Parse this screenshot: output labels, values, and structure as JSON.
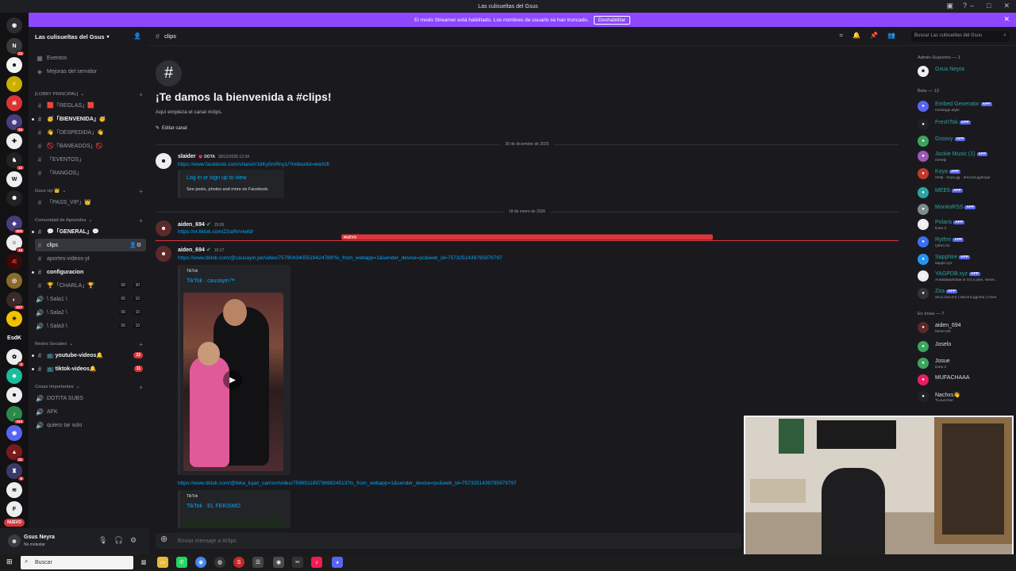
{
  "window": {
    "title": "Las culisueltas del Gsus"
  },
  "banner": {
    "text": "El modo Streamer está habilitado. Los nombres de usuario se han truncado.",
    "button": "Deshabilitar",
    "color": "#8c47ff"
  },
  "server": {
    "name": "Las culisueltas del Gsus"
  },
  "rail": {
    "badges": [
      "23",
      "34",
      "12",
      "606",
      "15",
      "927",
      "3",
      "164",
      "21",
      "8"
    ],
    "label_esdk": "EsdK",
    "new_label": "NUEVO"
  },
  "sidebar": {
    "top": [
      "Eventos",
      "Mejoras del servidor"
    ],
    "cat_lobby": "[LOBBY PRINCIPAL]",
    "lobby": [
      "🟥「REGLAS」🟥",
      "🥳「BIENVENIDA」🥳",
      "👋「DESPEDIDA」👋",
      "🚫「BANEADOS」🚫",
      "「EVENTOS」",
      "「RANGOS」"
    ],
    "cat_vip": "Gsus vip 👑",
    "vip": [
      "「PASS_VIP」👑"
    ],
    "cat_apostoles": "Comunidad de Apóstoles",
    "apostoles": [
      "💬「GENERAL」💬",
      "clips",
      "aportes-videos-yt",
      "configuracion",
      "🏆「CHARLA」🏆",
      "\\ Sala1 \\",
      "\\ Sala2 \\",
      "\\ Sala3 \\"
    ],
    "voice_counts": {
      "charla_a": "00",
      "charla_b": "30",
      "sala_a": "00",
      "sala_b": "10"
    },
    "cat_redes": "Redes Sociales",
    "redes": [
      "📺 youtube-videos🔔",
      "📺 tiktok-videos🔔"
    ],
    "redes_badges": [
      "22",
      "11"
    ],
    "cat_cosas": "Cosas Importantes",
    "cosas": [
      "DOTITA SUBS",
      "AFK",
      "quiero tar solo"
    ]
  },
  "user": {
    "name": "Gsus Neyra",
    "status": "No molestar"
  },
  "chat": {
    "channel": "clips",
    "search_placeholder": "Buscar Las culisueltas del Gsus",
    "welcome_title": "¡Te damos la bienvenida a #clips!",
    "welcome_sub": "Aquí empieza el canal #clips.",
    "edit_button": "Editar canal",
    "date1": "30 de diciembre de 2025",
    "date2": "18 de enero de 2026",
    "new_label": "NUEVO",
    "composer_placeholder": "Enviar mensaje a #clips",
    "messages": [
      {
        "author": "slaider",
        "tag": "💗 DOTA",
        "time": "30/12/2025 12:34",
        "link": "https://www.facebook.com/share/r/18Ky5mRny1/?mibextid=wwXIfr",
        "embed_title": "Log in or sign up to view",
        "embed_desc": "See posts, photos and more on Facebook."
      },
      {
        "author": "aiden_694",
        "time": "15:06",
        "link": "https://vt.tiktok.com/ZSaRmnwfd/"
      },
      {
        "author": "aiden_694",
        "time": "15:17",
        "link": "https://www.tiktok.com/@causayin.pe/video/7579043405519424789?is_from_webapp=1&sender_device=pc&web_id=7573251439795979797",
        "embed_provider": "TikTok",
        "embed_title": "TikTok · causayin™"
      },
      {
        "link2": "https://www.tiktok.com/@feka_lujan_carrion/video/7596511897369824513?is_from_webapp=1&sender_device=pc&web_id=7573251439795979797",
        "embed_provider": "TikTok",
        "embed_title": "TikTok · EL FEKISMO"
      }
    ]
  },
  "members": {
    "cat_admin": "Admin-Supremo — 1",
    "admin": [
      {
        "name": "Gsus Neyra"
      }
    ],
    "cat_bots": "Bots — 12",
    "app_label": "APP",
    "bots": [
      {
        "name": "Embed Generator",
        "status": "message.style"
      },
      {
        "name": "FreshTok",
        "status": ""
      },
      {
        "name": "Groovy",
        "status": ""
      },
      {
        "name": "Jockie Music (1)",
        "status": "m!help"
      },
      {
        "name": "Koya",
        "status": "/help · koya.gg · discord.gg/koya"
      },
      {
        "name": "MEE6",
        "status": ""
      },
      {
        "name": "MonitoRSS",
        "status": ""
      },
      {
        "name": "Polaris",
        "status": "Dota 2"
      },
      {
        "name": "Rythm",
        "status": "rythm.fm"
      },
      {
        "name": "Sapphire",
        "status": "sapph.xyz"
      },
      {
        "name": "YAGPDB.xyz",
        "status": "Anatidaephobia is not a joke, sever..."
      },
      {
        "name": "Zira",
        "status": "docs.zira.bot | discord.gg/zira | Clust"
      }
    ],
    "cat_online": "En línea — 7",
    "online": [
      {
        "name": "aiden_694",
        "status": "Minecraft"
      },
      {
        "name": "Joselo",
        "status": ""
      },
      {
        "name": "Josue",
        "status": "Dota 2"
      },
      {
        "name": "MUFACHAAA",
        "status": ""
      },
      {
        "name": "Nachxs👋",
        "status": "TLauncher"
      }
    ]
  },
  "taskbar": {
    "search": "Buscar"
  }
}
